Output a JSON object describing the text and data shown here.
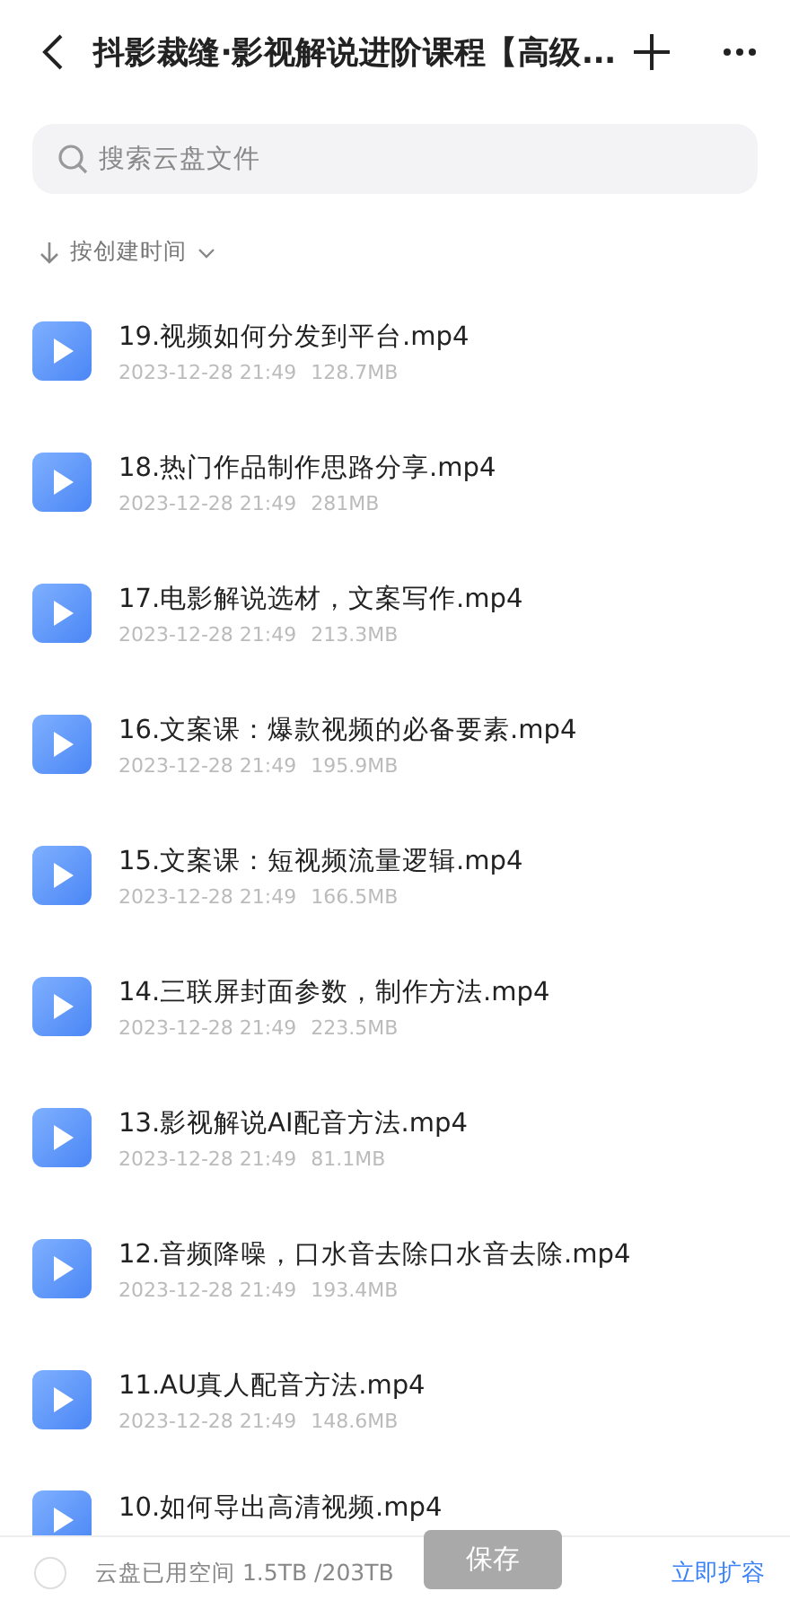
{
  "header": {
    "title": "抖影裁缝·影视解说进阶课程【高级..."
  },
  "search": {
    "placeholder": "搜索云盘文件"
  },
  "sort": {
    "label": "按创建时间"
  },
  "files": [
    {
      "name": "19.视频如何分发到平台.mp4",
      "date": "2023-12-28 21:49",
      "size": "128.7MB"
    },
    {
      "name": "18.热门作品制作思路分享.mp4",
      "date": "2023-12-28 21:49",
      "size": "281MB"
    },
    {
      "name": "17.电影解说选材，文案写作.mp4",
      "date": "2023-12-28 21:49",
      "size": "213.3MB"
    },
    {
      "name": "16.文案课：爆款视频的必备要素.mp4",
      "date": "2023-12-28 21:49",
      "size": "195.9MB"
    },
    {
      "name": "15.文案课：短视频流量逻辑.mp4",
      "date": "2023-12-28 21:49",
      "size": "166.5MB"
    },
    {
      "name": "14.三联屏封面参数，制作方法.mp4",
      "date": "2023-12-28 21:49",
      "size": "223.5MB"
    },
    {
      "name": "13.影视解说AI配音方法.mp4",
      "date": "2023-12-28 21:49",
      "size": "81.1MB"
    },
    {
      "name": "12.音频降噪，口水音去除口水音去除.mp4",
      "date": "2023-12-28 21:49",
      "size": "193.4MB"
    },
    {
      "name": "11.AU真人配音方法.mp4",
      "date": "2023-12-28 21:49",
      "size": "148.6MB"
    },
    {
      "name": "10.如何导出高清视频.mp4"
    }
  ],
  "footer": {
    "checked": false,
    "storage": "云盘已用空间 1.5TB /203TB",
    "save": "保存",
    "expand": "立即扩容"
  }
}
